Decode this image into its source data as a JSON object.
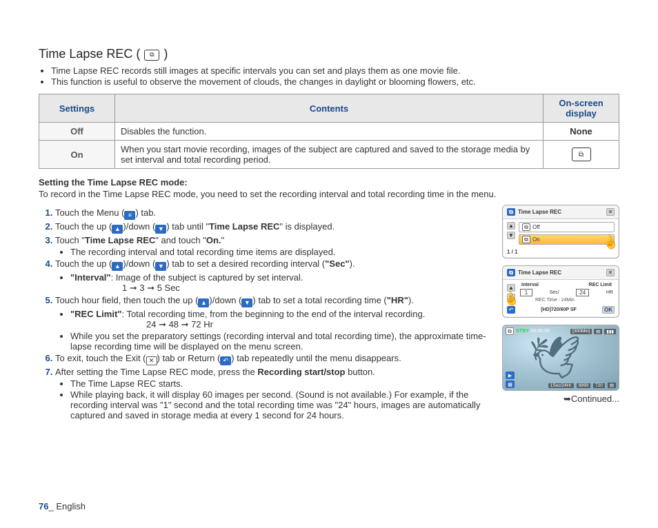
{
  "title": "Time Lapse REC (",
  "title_end": ")",
  "intro": [
    "Time Lapse REC records still images at specific intervals you can set and plays them as one movie file.",
    "This function is useful to observe the movement of clouds, the changes in daylight or blooming flowers, etc."
  ],
  "table": {
    "headers": {
      "settings": "Settings",
      "contents": "Contents",
      "display": "On-screen display"
    },
    "rows": [
      {
        "setting": "Off",
        "content": "Disables the function.",
        "display": "None",
        "icon": false
      },
      {
        "setting": "On",
        "content": "When you start movie recording, images of the subject are captured and saved to the storage media by set interval and total recording period.",
        "display": "",
        "icon": true
      }
    ]
  },
  "subtitle": "Setting the Time Lapse REC mode:",
  "subtitle_desc": "To record in the Time Lapse REC mode, you need to set the recording interval and total recording time in the menu.",
  "steps": {
    "s1": "Touch the Menu (",
    "s1b": ") tab.",
    "s2a": "Touch the up (",
    "s2b": ")/down (",
    "s2c": ") tab until \"",
    "s2d": "Time Lapse REC",
    "s2e": "\" is displayed.",
    "s3a": "Touch \"",
    "s3b": "Time Lapse REC",
    "s3c": "\" and touch \"",
    "s3d": "On.",
    "s3e": "\"",
    "s3_sub": "The recording interval and total recording time items are displayed.",
    "s4a": "Touch the up (",
    "s4b": ")/down (",
    "s4c": ") tab to set a desired recording interval (",
    "s4d": "\"Sec\"",
    "s4e": ").",
    "s4_sub_label": "\"Interval\"",
    "s4_sub_text": ": Image of the subject is captured by set interval.",
    "s4_seq": "1 ➞ 3 ➞ 5 Sec",
    "s5a": "Touch hour field, then touch the up (",
    "s5b": ")/down (",
    "s5c": ") tab to set a total recording time (",
    "s5d": "\"HR\"",
    "s5e": ").",
    "s5_sub_label": "\"REC Limit\"",
    "s5_sub_text": ": Total recording time, from the beginning to the end of the interval recording.",
    "s5_seq": "24 ➞ 48 ➞ 72 Hr",
    "s5_note": "While you set the preparatory settings (recording interval and total recording time), the approximate time-lapse recording time will be displayed on the menu screen.",
    "s6a": "To exit, touch the Exit (",
    "s6b": ") tab or Return (",
    "s6c": ") tab repeatedly until the menu disappears.",
    "s7a": "After setting the Time Lapse REC mode, press the ",
    "s7b": "Recording start/stop",
    "s7c": " button.",
    "s7_sub1": "The Time Lapse REC starts.",
    "s7_sub2": "While playing back, it will display 60 images per second. (Sound is not available.) For example, if the recording interval was \"1\" second and the total recording time was \"24\" hours, images are automatically captured and saved in storage media at every 1 second for 24 hours."
  },
  "menu1": {
    "title": "Time Lapse REC",
    "off": "Off",
    "on": "On",
    "page": "1 / 1"
  },
  "menu2": {
    "title": "Time Lapse REC",
    "interval_label": "Interval",
    "reclimit_label": "REC Limit",
    "interval_val": "1",
    "sec_unit": "Sec/",
    "reclimit_val": "24",
    "hr_unit": "HR",
    "rec_time": "REC Time : 24Min",
    "format": "[HD]720/60P SF",
    "ok": "OK"
  },
  "playback": {
    "stby": "STBY",
    "time": "00:00:00",
    "remain": "[300Min]",
    "bottom_time": "1Sec/24Hr",
    "count": "9999"
  },
  "continued": "➥Continued...",
  "footer": {
    "page": "76",
    "sep": "_ ",
    "lang": "English"
  }
}
